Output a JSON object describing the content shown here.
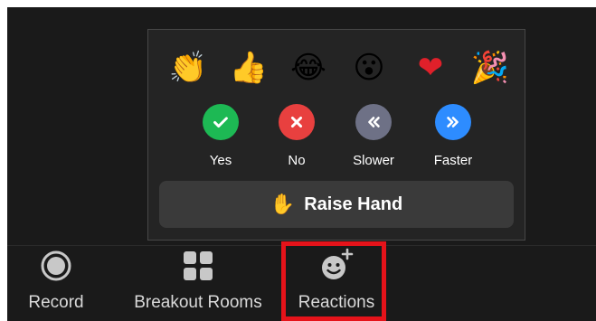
{
  "reactions_panel": {
    "emojis": [
      {
        "name": "clapping-hands",
        "glyph": "👏"
      },
      {
        "name": "thumbs-up",
        "glyph": "👍"
      },
      {
        "name": "tears-of-joy",
        "glyph": "😂"
      },
      {
        "name": "open-mouth",
        "glyph": "😮"
      },
      {
        "name": "red-heart",
        "glyph": "❤"
      },
      {
        "name": "party-popper",
        "glyph": "🎉"
      }
    ],
    "feedback": [
      {
        "label": "Yes",
        "color": "#1db954"
      },
      {
        "label": "No",
        "color": "#e8403f"
      },
      {
        "label": "Slower",
        "color": "#6e7186"
      },
      {
        "label": "Faster",
        "color": "#2d8cff"
      }
    ],
    "raise_hand": {
      "glyph": "✋",
      "label": "Raise Hand"
    }
  },
  "toolbar": {
    "record_label": "Record",
    "breakout_label": "Breakout Rooms",
    "reactions_label": "Reactions"
  },
  "colors": {
    "background": "#1a1a1a",
    "panel": "#242424",
    "highlight": "#e5131a"
  }
}
